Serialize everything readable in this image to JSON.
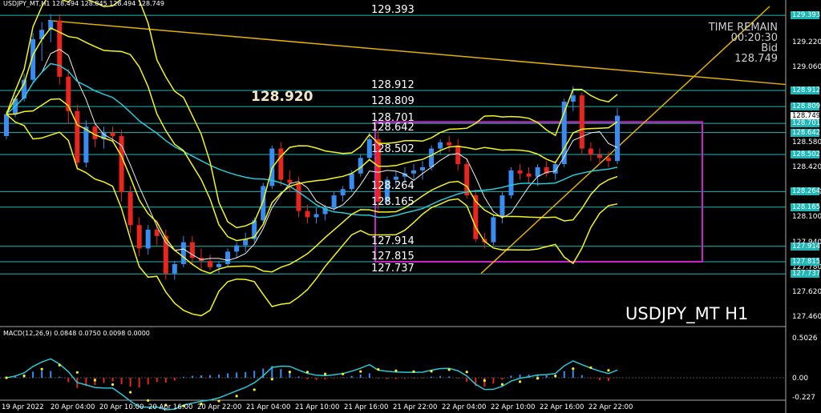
{
  "header": {
    "info": "USDJPY_MT,H1  128.494 128.845 128.494 128.749"
  },
  "timer": {
    "title": "TIME REMAIN",
    "remaining": "00:20:30",
    "bid_label": "Bid",
    "bid_value": "128.749"
  },
  "symbol_label": "USDJPY_MT H1",
  "big_price": "128.920",
  "horizontal_levels": [
    {
      "label": "129.393",
      "value": 129.393
    },
    {
      "label": "128.912",
      "value": 128.912
    },
    {
      "label": "128.809",
      "value": 128.809
    },
    {
      "label": "128.701",
      "value": 128.701
    },
    {
      "label": "128.642",
      "value": 128.642
    },
    {
      "label": "128.502",
      "value": 128.502
    },
    {
      "label": "128.264",
      "value": 128.264
    },
    {
      "label": "128.165",
      "value": 128.165
    },
    {
      "label": "127.914",
      "value": 127.914
    },
    {
      "label": "127.815",
      "value": 127.815
    },
    {
      "label": "127.737",
      "value": 127.737
    }
  ],
  "price_axis": {
    "ticks": [
      "129.220",
      "129.060",
      "128.420",
      "128.260",
      "128.100",
      "127.940",
      "127.780",
      "127.620",
      "127.460",
      "128.580"
    ],
    "tagged": [
      "129.393",
      "128.912",
      "128.809",
      "128.749",
      "128.701",
      "128.642",
      "128.502",
      "128.264",
      "128.165",
      "127.914",
      "127.815",
      "127.737"
    ],
    "current": "128.749"
  },
  "macd": {
    "info": "MACD(12,26,9) 0.0848 0.0750 0.0098 0.0000",
    "ticks": [
      "0.5026",
      "0.00",
      "-0.227"
    ]
  },
  "time_axis": [
    "19 Apr 2022",
    "20 Apr 04:00",
    "20 Apr 10:00",
    "20 Apr 16:00",
    "20 Apr 22:00",
    "21 Apr 04:00",
    "21 Apr 10:00",
    "21 Apr 16:00",
    "21 Apr 22:00",
    "22 Apr 04:00",
    "22 Apr 10:00",
    "22 Apr 16:00",
    "22 Apr 22:00"
  ],
  "colors": {
    "bull": "#3a8df0",
    "bear": "#e8261e",
    "level_line": "#1fb6b6",
    "bollinger": "#f5f51c",
    "box": "#cc22cc",
    "trendline": "#e3b100",
    "ma_fast": "#f0f0f0",
    "ma_slow": "#28c8d8"
  },
  "chart_data": {
    "type": "candlestick",
    "symbol": "USDJPY_MT",
    "timeframe": "H1",
    "ylim": [
      127.4,
      129.45
    ],
    "candles": [
      [
        128.62,
        128.78,
        128.6,
        128.76
      ],
      [
        128.76,
        128.88,
        128.74,
        128.86
      ],
      [
        128.86,
        129.02,
        128.84,
        128.98
      ],
      [
        128.98,
        129.28,
        128.96,
        129.24
      ],
      [
        129.24,
        129.35,
        129.1,
        129.3
      ],
      [
        129.3,
        129.4,
        129.22,
        129.36
      ],
      [
        129.36,
        129.4,
        128.95,
        129.0
      ],
      [
        129.0,
        129.05,
        128.7,
        128.78
      ],
      [
        128.78,
        128.82,
        128.4,
        128.45
      ],
      [
        128.45,
        128.72,
        128.42,
        128.68
      ],
      [
        128.68,
        128.7,
        128.55,
        128.6
      ],
      [
        128.6,
        128.68,
        128.54,
        128.64
      ],
      [
        128.64,
        128.68,
        128.58,
        128.62
      ],
      [
        128.62,
        128.66,
        128.2,
        128.26
      ],
      [
        128.26,
        128.3,
        128.0,
        128.05
      ],
      [
        128.05,
        128.1,
        127.85,
        127.9
      ],
      [
        127.9,
        128.05,
        127.86,
        128.02
      ],
      [
        128.02,
        128.08,
        127.92,
        127.98
      ],
      [
        127.98,
        128.02,
        127.7,
        127.74
      ],
      [
        127.74,
        127.82,
        127.7,
        127.8
      ],
      [
        127.8,
        127.98,
        127.78,
        127.94
      ],
      [
        127.94,
        127.98,
        127.8,
        127.84
      ],
      [
        127.84,
        127.9,
        127.76,
        127.82
      ],
      [
        127.82,
        127.86,
        127.76,
        127.78
      ],
      [
        127.78,
        127.82,
        127.74,
        127.8
      ],
      [
        127.8,
        127.9,
        127.78,
        127.88
      ],
      [
        127.88,
        127.94,
        127.84,
        127.92
      ],
      [
        127.92,
        128.0,
        127.88,
        127.96
      ],
      [
        127.96,
        128.1,
        127.94,
        128.08
      ],
      [
        128.08,
        128.32,
        128.06,
        128.3
      ],
      [
        128.3,
        128.56,
        128.28,
        128.54
      ],
      [
        128.54,
        128.58,
        128.3,
        128.34
      ],
      [
        128.34,
        128.4,
        128.26,
        128.32
      ],
      [
        128.32,
        128.36,
        128.1,
        128.14
      ],
      [
        128.14,
        128.18,
        128.06,
        128.1
      ],
      [
        128.1,
        128.16,
        128.06,
        128.12
      ],
      [
        128.12,
        128.18,
        128.08,
        128.16
      ],
      [
        128.16,
        128.26,
        128.14,
        128.24
      ],
      [
        128.24,
        128.3,
        128.2,
        128.28
      ],
      [
        128.28,
        128.4,
        128.26,
        128.38
      ],
      [
        128.38,
        128.5,
        128.36,
        128.48
      ],
      [
        128.48,
        128.64,
        128.46,
        128.6
      ],
      [
        128.6,
        128.66,
        128.14,
        128.2
      ],
      [
        128.2,
        128.36,
        128.18,
        128.34
      ],
      [
        128.34,
        128.4,
        128.3,
        128.36
      ],
      [
        128.36,
        128.42,
        128.32,
        128.38
      ],
      [
        128.38,
        128.44,
        128.34,
        128.4
      ],
      [
        128.4,
        128.46,
        128.34,
        128.42
      ],
      [
        128.42,
        128.56,
        128.4,
        128.54
      ],
      [
        128.54,
        128.6,
        128.5,
        128.58
      ],
      [
        128.58,
        128.62,
        128.52,
        128.56
      ],
      [
        128.56,
        128.6,
        128.4,
        128.44
      ],
      [
        128.44,
        128.48,
        128.22,
        128.24
      ],
      [
        128.24,
        128.28,
        127.94,
        127.96
      ],
      [
        127.96,
        128.0,
        127.9,
        127.94
      ],
      [
        127.94,
        128.12,
        127.92,
        128.1
      ],
      [
        128.1,
        128.26,
        128.06,
        128.24
      ],
      [
        128.24,
        128.42,
        128.22,
        128.4
      ],
      [
        128.4,
        128.44,
        128.34,
        128.38
      ],
      [
        128.38,
        128.42,
        128.32,
        128.36
      ],
      [
        128.36,
        128.44,
        128.3,
        128.42
      ],
      [
        128.42,
        128.46,
        128.36,
        128.38
      ],
      [
        128.38,
        128.46,
        128.34,
        128.44
      ],
      [
        128.44,
        128.86,
        128.42,
        128.84
      ],
      [
        128.84,
        128.94,
        128.78,
        128.88
      ],
      [
        128.88,
        128.9,
        128.5,
        128.54
      ],
      [
        128.54,
        128.58,
        128.46,
        128.5
      ],
      [
        128.5,
        128.54,
        128.44,
        128.48
      ],
      [
        128.48,
        128.52,
        128.42,
        128.46
      ],
      [
        128.46,
        128.8,
        128.44,
        128.75
      ]
    ]
  }
}
